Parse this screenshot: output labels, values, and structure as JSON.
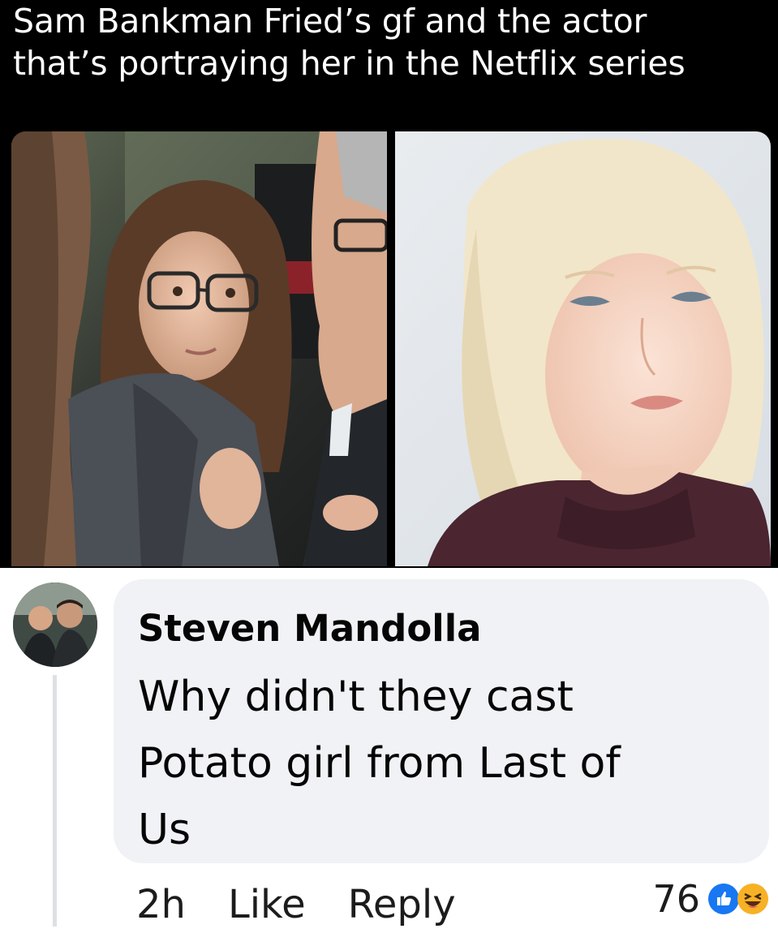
{
  "post": {
    "caption_line1": "Sam Bankman Fried’s gf and the actor",
    "caption_line2": "that’s portraying her in the Netflix series"
  },
  "comment": {
    "author": "Steven Mandolla",
    "text_line1": "Why didn't they cast",
    "text_line2": "Potato girl from Last of",
    "text_line3": "Us",
    "time": "2h",
    "like_label": "Like",
    "reply_label": "Reply",
    "reaction_count": "76",
    "reaction_icons": [
      "like-icon",
      "haha-icon"
    ]
  },
  "colors": {
    "background_top": "#000000",
    "bubble": "#f0f2f5",
    "like_blue": "#1877f2",
    "haha_yellow": "#f7b125"
  }
}
